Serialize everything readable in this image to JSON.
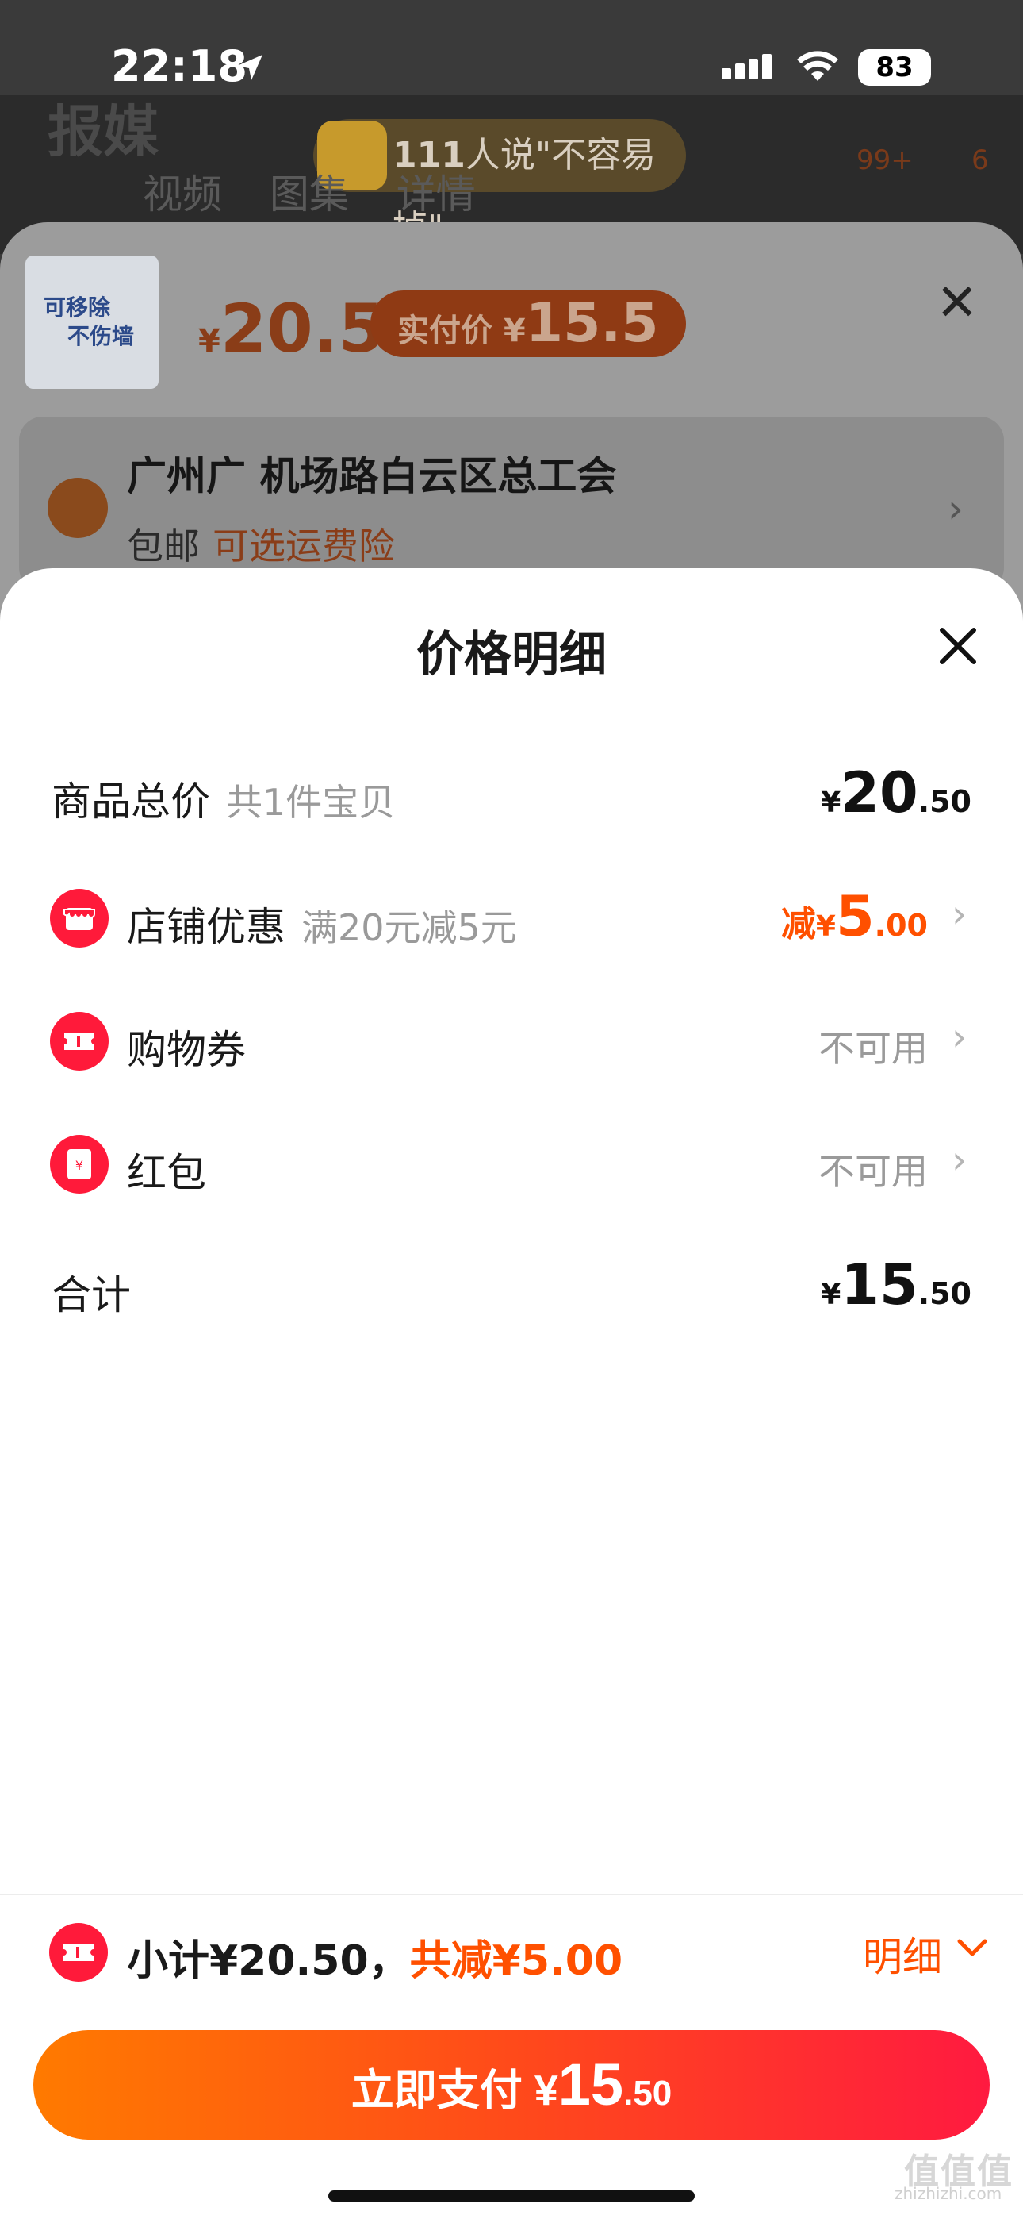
{
  "status_bar": {
    "time": "22:18",
    "battery": "83"
  },
  "background": {
    "page_title": "报媒",
    "banner_count": "111",
    "banner_text": "人说\"不容易掉\"",
    "tabs": [
      "视频",
      "图集",
      "详情"
    ],
    "cart_badge": "99+",
    "more_badge": "6"
  },
  "product_sheet": {
    "thumbnail_text_1": "可移除",
    "thumbnail_text_2": "不伤墙",
    "price_yen": "¥",
    "price": "20.5",
    "real_pay_label": "实付价 ¥",
    "real_pay_value": "15.5",
    "address": "广州广 机场路白云区总工会",
    "shipping": "包邮",
    "shipping_insurance": "可选运费险"
  },
  "price_detail": {
    "title": "价格明细",
    "rows": {
      "goods_total": {
        "label": "商品总价",
        "sub": "共1件宝贝",
        "yen": "¥",
        "int": "20",
        "dec": ".50"
      },
      "shop_discount": {
        "label": "店铺优惠",
        "sub": "满20元减5元",
        "prefix": "减",
        "yen": "¥",
        "int": "5",
        "dec": ".00"
      },
      "coupon": {
        "label": "购物券",
        "value": "不可用"
      },
      "red_packet": {
        "label": "红包",
        "value": "不可用"
      },
      "total": {
        "label": "合计",
        "yen": "¥",
        "int": "15",
        "dec": ".50"
      }
    }
  },
  "bottom_bar": {
    "subtotal": "小计¥20.50，",
    "total_reduce": "共减¥5.00",
    "detail_label": "明细",
    "pay_label": "立即支付 ¥",
    "pay_int": "15",
    "pay_dec": ".50"
  },
  "watermark": {
    "text": "值值值",
    "url": "zhizhizhi.com"
  },
  "colors": {
    "accent": "#ff5000",
    "icon_red": "#ff1a3a"
  }
}
